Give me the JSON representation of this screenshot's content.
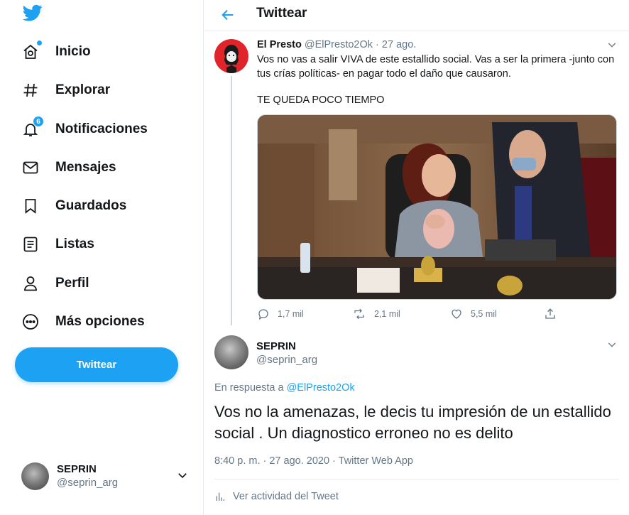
{
  "sidebar": {
    "nav": [
      {
        "label": "Inicio",
        "icon": "home-icon"
      },
      {
        "label": "Explorar",
        "icon": "hashtag-icon"
      },
      {
        "label": "Notificaciones",
        "icon": "bell-icon",
        "badge": "6"
      },
      {
        "label": "Mensajes",
        "icon": "envelope-icon"
      },
      {
        "label": "Guardados",
        "icon": "bookmark-icon"
      },
      {
        "label": "Listas",
        "icon": "list-icon"
      },
      {
        "label": "Perfil",
        "icon": "person-icon"
      },
      {
        "label": "Más opciones",
        "icon": "more-circle-icon"
      }
    ],
    "tweet_button": "Twittear",
    "account": {
      "name": "SEPRIN",
      "handle": "@seprin_arg"
    }
  },
  "header": {
    "title": "Twittear"
  },
  "parent_tweet": {
    "name": "El Presto",
    "handle": "@ElPresto2Ok",
    "separator": "·",
    "date": "27 ago.",
    "text": "Vos no vas a salir VIVA de este estallido social. Vas a ser la primera -junto con tus crías políticas- en pagar todo el daño que causaron.",
    "text2": "TE QUEDA POCO TIEMPO",
    "replies": "1,7 mil",
    "retweets": "2,1 mil",
    "likes": "5,5 mil"
  },
  "focused_tweet": {
    "name": "SEPRIN",
    "handle": "@seprin_arg",
    "in_reply_prefix": "En respuesta a",
    "in_reply_handle": "@ElPresto2Ok",
    "text": "Vos no la amenazas, le decis tu impresión de un estallido social . Un diagnostico erroneo no es delito",
    "meta": "8:40 p. m. · 27 ago. 2020 · Twitter Web App",
    "activity": "Ver actividad del Tweet"
  },
  "colors": {
    "accent": "#1da1f2",
    "text": "#14171a",
    "secondary": "#657786",
    "border": "#e6ecf0"
  }
}
